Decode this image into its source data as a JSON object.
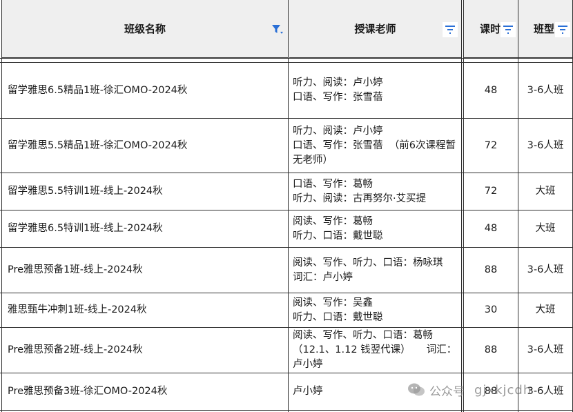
{
  "table": {
    "headers": {
      "class_name": "班级名称",
      "teacher": "授课老师",
      "hours": "课时",
      "type": "班型"
    },
    "rows": [
      {
        "name": "留学雅思6.5精品1班-徐汇OMO-2024秋",
        "teacher": "听力、阅读：卢小婷\n口语、写作：张雪蓓",
        "hours": "48",
        "type": "3-6人班"
      },
      {
        "name": "留学雅思5.5精品1班-徐汇OMO-2024秋",
        "teacher": "听力、阅读：卢小婷\n口语、写作：张雪蓓  （前6次课程暂无老师）",
        "hours": "72",
        "type": "3-6人班"
      },
      {
        "name": "留学雅思5.5特训1班-线上-2024秋",
        "teacher": "口语、写作：葛畅\n听力、阅读：古再努尔·艾买提",
        "hours": "72",
        "type": "大班"
      },
      {
        "name": "留学雅思6.5特训1班-线上-2024秋",
        "teacher": "阅读、写作：葛畅\n听力、口语：戴世聪",
        "hours": "48",
        "type": "大班"
      },
      {
        "name": "Pre雅思预备1班-线上-2024秋",
        "teacher": "阅读、写作、听力、口语：杨咏琪          词汇：卢小婷",
        "hours": "88",
        "type": "3-6人班"
      },
      {
        "name": "雅思甄牛冲刺1班-线上-2024秋",
        "teacher": "阅读、写作：吴鑫\n听力、口语：戴世聪",
        "hours": "30",
        "type": "大班"
      },
      {
        "name": "Pre雅思预备2班-线上-2024秋",
        "teacher": "阅读、写作、听力、口语：葛畅（12.1、1.12 钱翌代课）     词汇：卢小婷",
        "hours": "88",
        "type": "3-6人班"
      },
      {
        "name": "Pre雅思预备3班-徐汇OMO-2024秋",
        "teacher": "卢小婷",
        "hours": "88",
        "type": "3-6人班"
      }
    ]
  },
  "watermark": {
    "label": "公众号",
    "id": "gjxkjcdh"
  },
  "colors": {
    "header_bg": "#efefef",
    "filter_icon": "#2a6fd6",
    "grid_line": "#2e2e2e"
  },
  "icons": [
    "filter-active-icon",
    "filter-icon",
    "wechat-icon"
  ]
}
